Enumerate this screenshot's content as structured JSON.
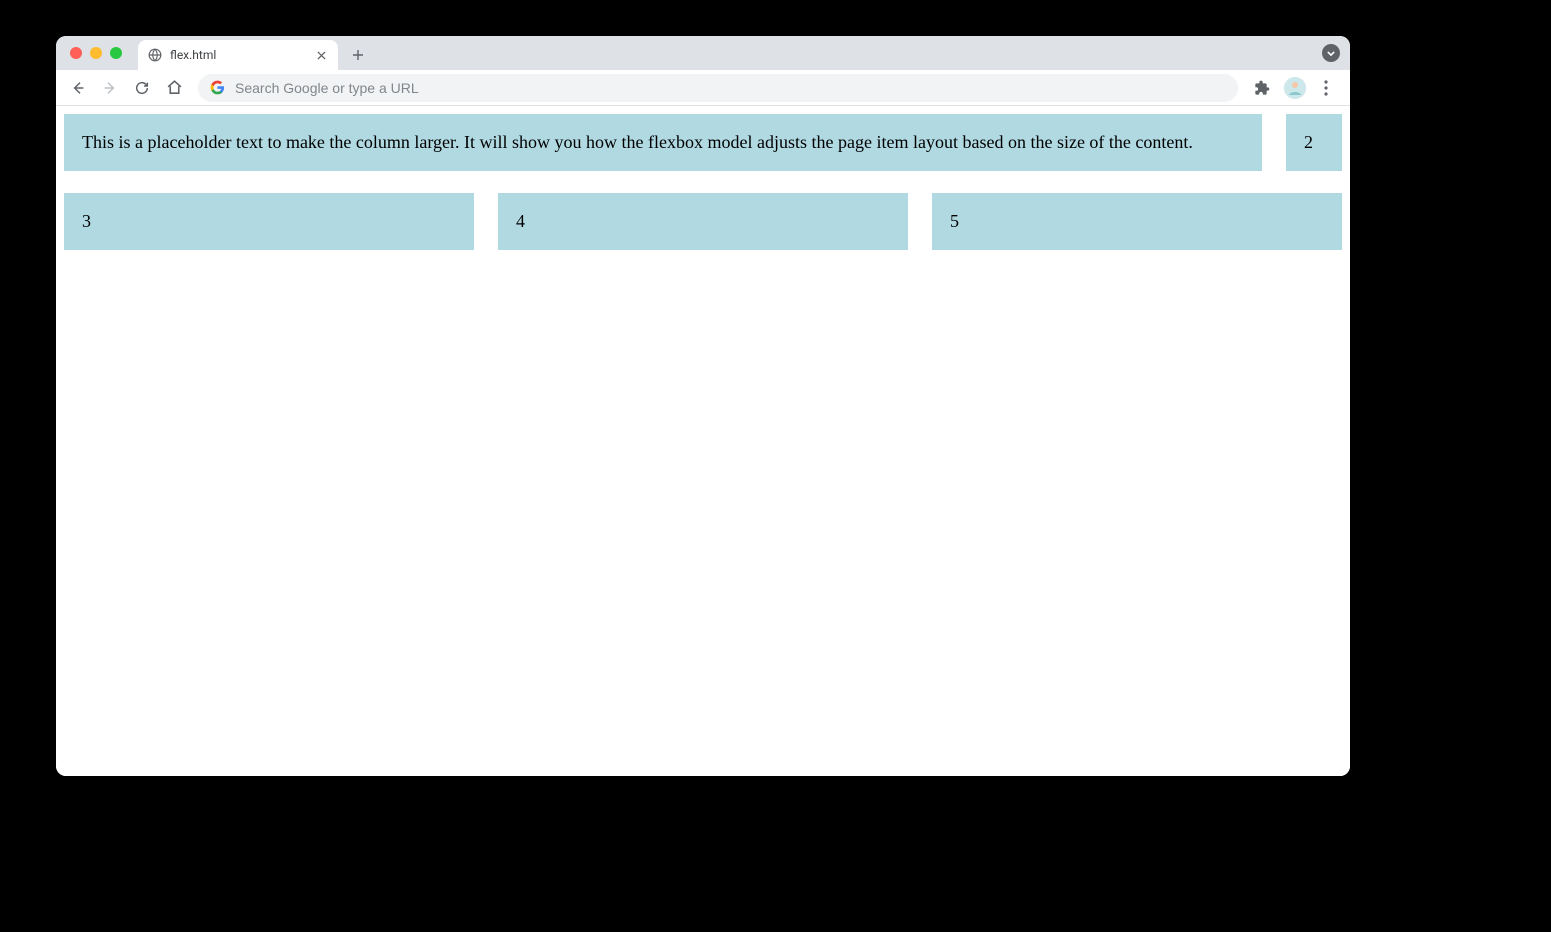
{
  "browser": {
    "tab": {
      "title": "flex.html"
    },
    "omnibox": {
      "placeholder": "Search Google or type a URL",
      "value": ""
    }
  },
  "page": {
    "boxes": {
      "box1": "This is a placeholder text to make the column larger. It will show you how the flexbox model adjusts the page item layout based on the size of the content.",
      "box2": "2",
      "box3": "3",
      "box4": "4",
      "box5": "5"
    },
    "colors": {
      "box_bg": "#b0d9e2"
    }
  }
}
